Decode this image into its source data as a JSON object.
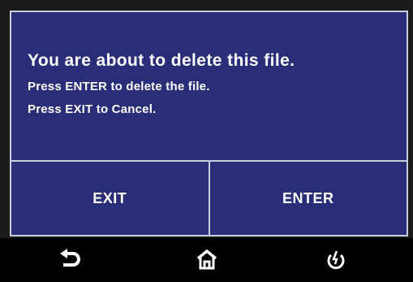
{
  "dialog": {
    "title": "You are about to delete this file.",
    "line1": "Press ENTER to delete the file.",
    "line2": "Press EXIT to Cancel.",
    "exit_label": "EXIT",
    "enter_label": "ENTER"
  },
  "footer": {
    "icons": [
      "back-icon",
      "home-icon",
      "power-icon"
    ]
  },
  "colors": {
    "dialog_background": "#2a2d78",
    "dialog_border": "#c9cde0",
    "text": "#ffffff",
    "footer_background": "#000000"
  }
}
